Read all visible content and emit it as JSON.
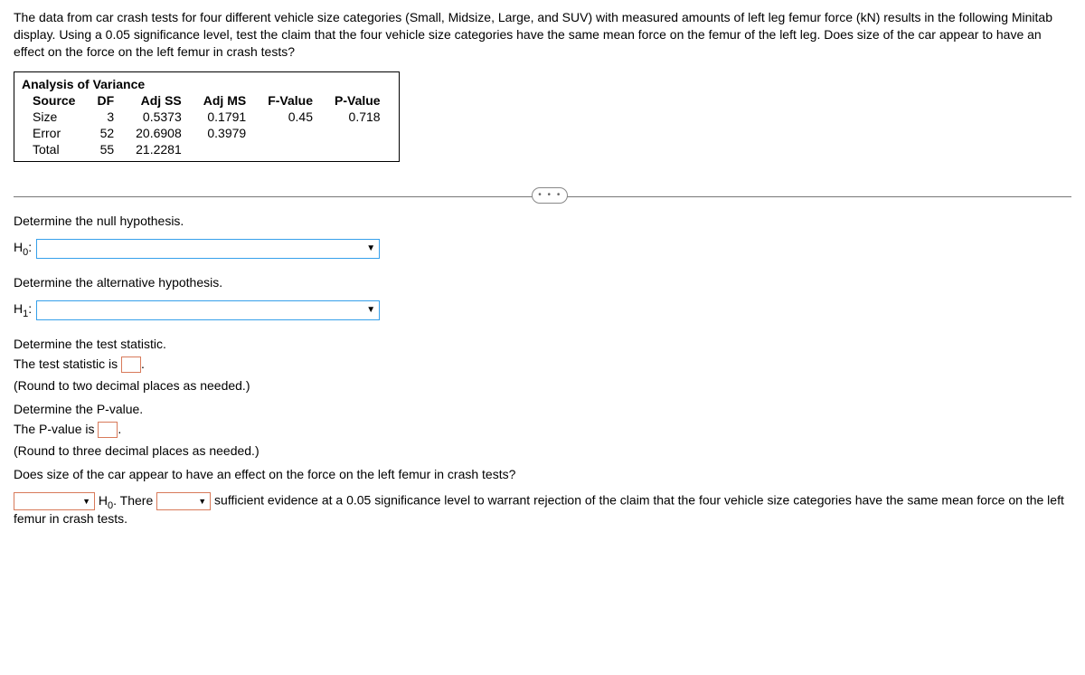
{
  "question": "The data from car crash tests for four different vehicle size categories (Small, Midsize, Large, and SUV) with measured amounts of left leg femur force (kN) results in the following Minitab display. Using a 0.05 significance level, test the claim that the four vehicle size categories have the same mean force on the femur of the left leg. Does size of the car appear to have an effect on the force on the left femur in crash tests?",
  "anova": {
    "title": "Analysis of Variance",
    "headers": {
      "c1": "Source",
      "c2": "DF",
      "c3": "Adj SS",
      "c4": "Adj MS",
      "c5": "F-Value",
      "c6": "P-Value"
    },
    "rows": [
      {
        "c1": "Size",
        "c2": "3",
        "c3": "0.5373",
        "c4": "0.1791",
        "c5": "0.45",
        "c6": "0.718"
      },
      {
        "c1": "Error",
        "c2": "52",
        "c3": "20.6908",
        "c4": "0.3979",
        "c5": "",
        "c6": ""
      },
      {
        "c1": "Total",
        "c2": "55",
        "c3": "21.2281",
        "c4": "",
        "c5": "",
        "c6": ""
      }
    ]
  },
  "prompts": {
    "nullLabel": "Determine the null hypothesis.",
    "h0": "H",
    "h0sub": "0",
    "colon": ":",
    "altLabel": "Determine the alternative hypothesis.",
    "h1": "H",
    "h1sub": "1",
    "testStatLabel": "Determine the test statistic.",
    "testStatLine1": "The test statistic is ",
    "testStatLine2": ".",
    "testStatHint": "(Round to two decimal places as needed.)",
    "pvalLabel": "Determine the P-value.",
    "pvalLine1": "The P-value is ",
    "pvalLine2": ".",
    "pvalHint": "(Round to three decimal places as needed.)",
    "conclusionQ": "Does size of the car appear to have an effect on the force on the left femur in crash tests?",
    "concPart1": " H",
    "concSub": "0",
    "concPart2": ". There ",
    "concPart3": " sufficient evidence at a 0.05 significance level to warrant rejection of the claim that the four vehicle size categories have the same mean force on the left femur in crash tests."
  },
  "ellipsis": "• • •"
}
